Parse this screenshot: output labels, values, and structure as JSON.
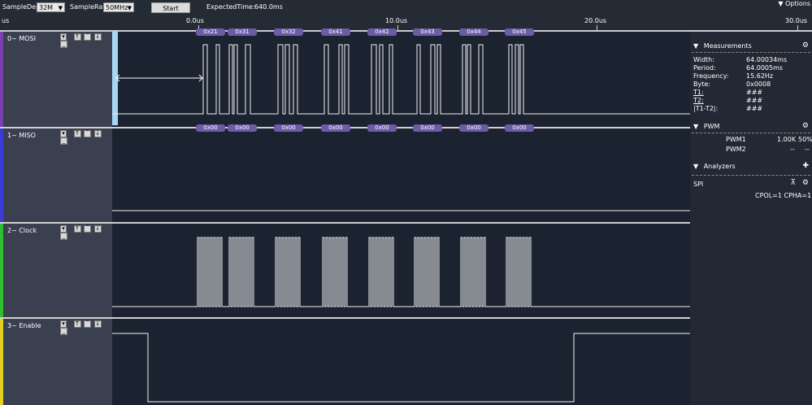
{
  "toolbar": {
    "sample_depth_label": "SampleDepth",
    "sample_depth_value": "32M",
    "sample_rate_label": "SampleRate",
    "sample_rate_value": "50MHz",
    "start_label": "Start",
    "expected_time_label": "ExpectedTime:",
    "expected_time_value": "640.0ms",
    "options_label": "Options"
  },
  "ruler": {
    "unit_prefix": "us",
    "ticks": [
      "0.0us",
      "10.0us",
      "20.0us",
      "30.0us"
    ]
  },
  "channels": [
    {
      "name": "0~ MOSI",
      "color": "#7b3fb0",
      "bus_values": [
        "0x21",
        "0x31",
        "0x32",
        "0x41",
        "0x42",
        "0x43",
        "0x44",
        "0x45"
      ]
    },
    {
      "name": "1~ MISO",
      "color": "#3b3bd8",
      "bus_values": [
        "0x00",
        "0x00",
        "0x00",
        "0x00",
        "0x00",
        "0x00",
        "0x00",
        "0x00"
      ]
    },
    {
      "name": "2~ Clock",
      "color": "#2fc02f"
    },
    {
      "name": "3~ Enable",
      "color": "#e0d020"
    }
  ],
  "measurements": {
    "title": "Measurements",
    "rows": [
      {
        "label": "Width:",
        "value": "64.00034ms"
      },
      {
        "label": "Period:",
        "value": "64.0005ms"
      },
      {
        "label": "Frequency:",
        "value": "15.62Hz"
      },
      {
        "label": "Byte:",
        "value": "0x0008"
      },
      {
        "label": "T1:",
        "value": "###"
      },
      {
        "label": "T2:",
        "value": "###"
      },
      {
        "label": "|T1-T2|:",
        "value": "###"
      }
    ]
  },
  "pwm": {
    "title": "PWM",
    "rows": [
      {
        "label": "PWM1",
        "freq": "1.00K",
        "duty": "50%"
      },
      {
        "label": "PWM2",
        "freq": "--",
        "duty": "--"
      }
    ]
  },
  "analyzers": {
    "title": "Analyzers",
    "item": "SPI",
    "params": "CPOL=1 CPHA=1"
  }
}
